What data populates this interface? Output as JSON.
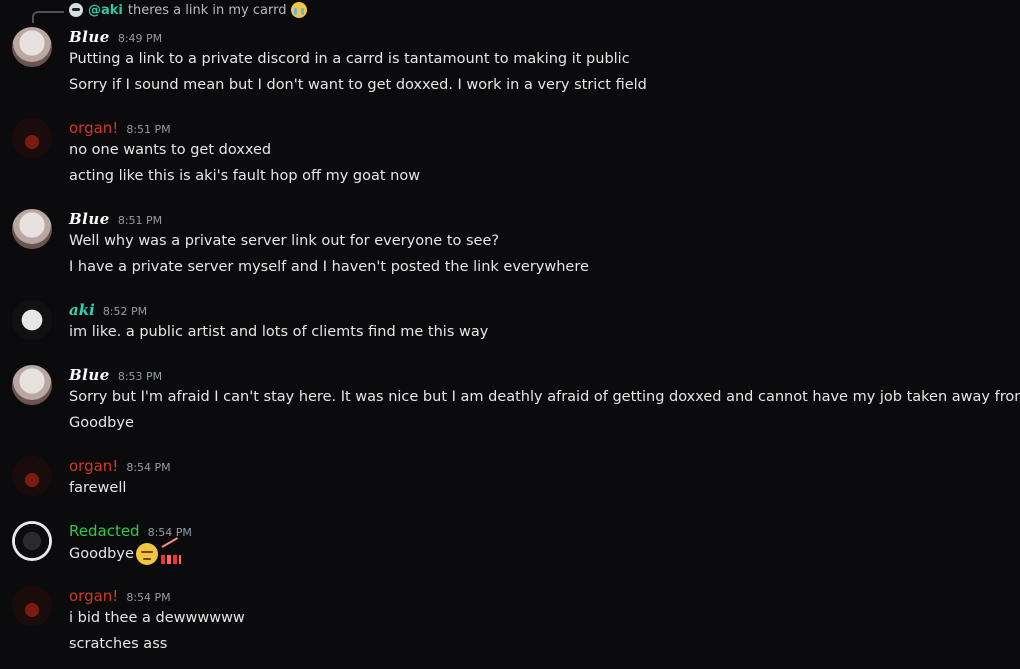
{
  "reply": {
    "author": "@aki",
    "text": "theres a link in my carrd",
    "emoji": "loudly-crying-face-emoji"
  },
  "messages": [
    {
      "author": "Blue",
      "time": "8:49 PM",
      "lines": [
        "Putting a link to a private discord in a carrd is tantamount to making it public",
        "Sorry if I sound mean but I don't want to get doxxed. I work in a very strict field"
      ]
    },
    {
      "author": "organ!",
      "time": "8:51 PM",
      "lines": [
        "no one wants to get doxxed",
        "acting like this is aki's fault hop off my goat now"
      ]
    },
    {
      "author": "Blue",
      "time": "8:51 PM",
      "lines": [
        "Well why was a private server link out for everyone to see?",
        "I have a private server myself and I haven't posted the link everywhere"
      ]
    },
    {
      "author": "aki",
      "time": "8:52 PM",
      "lines": [
        "im like. a public artist and lots of cliemts find me this way"
      ]
    },
    {
      "author": "Blue",
      "time": "8:53 PM",
      "lines": [
        "Sorry but I'm afraid I can't stay here. It was nice but I am deathly afraid of getting doxxed and cannot have my job taken away from me",
        "Goodbye"
      ]
    },
    {
      "author": "organ!",
      "time": "8:54 PM",
      "lines": [
        "farewell"
      ]
    },
    {
      "author": "Redacted",
      "time": "8:54 PM",
      "lines": [
        "Goodbye"
      ],
      "emojis": [
        "pensive-face-emoji",
        "chart-decreasing-emoji"
      ]
    },
    {
      "author": "organ!",
      "time": "8:54 PM",
      "lines": [
        "i bid thee a dewwwwww",
        "scratches ass"
      ]
    }
  ],
  "colors": {
    "background": "#0b0b0d",
    "organ": "#d03a1e",
    "aki": "#34d3b0",
    "redacted": "#2ecc40",
    "timestamp": "#949ba4"
  }
}
